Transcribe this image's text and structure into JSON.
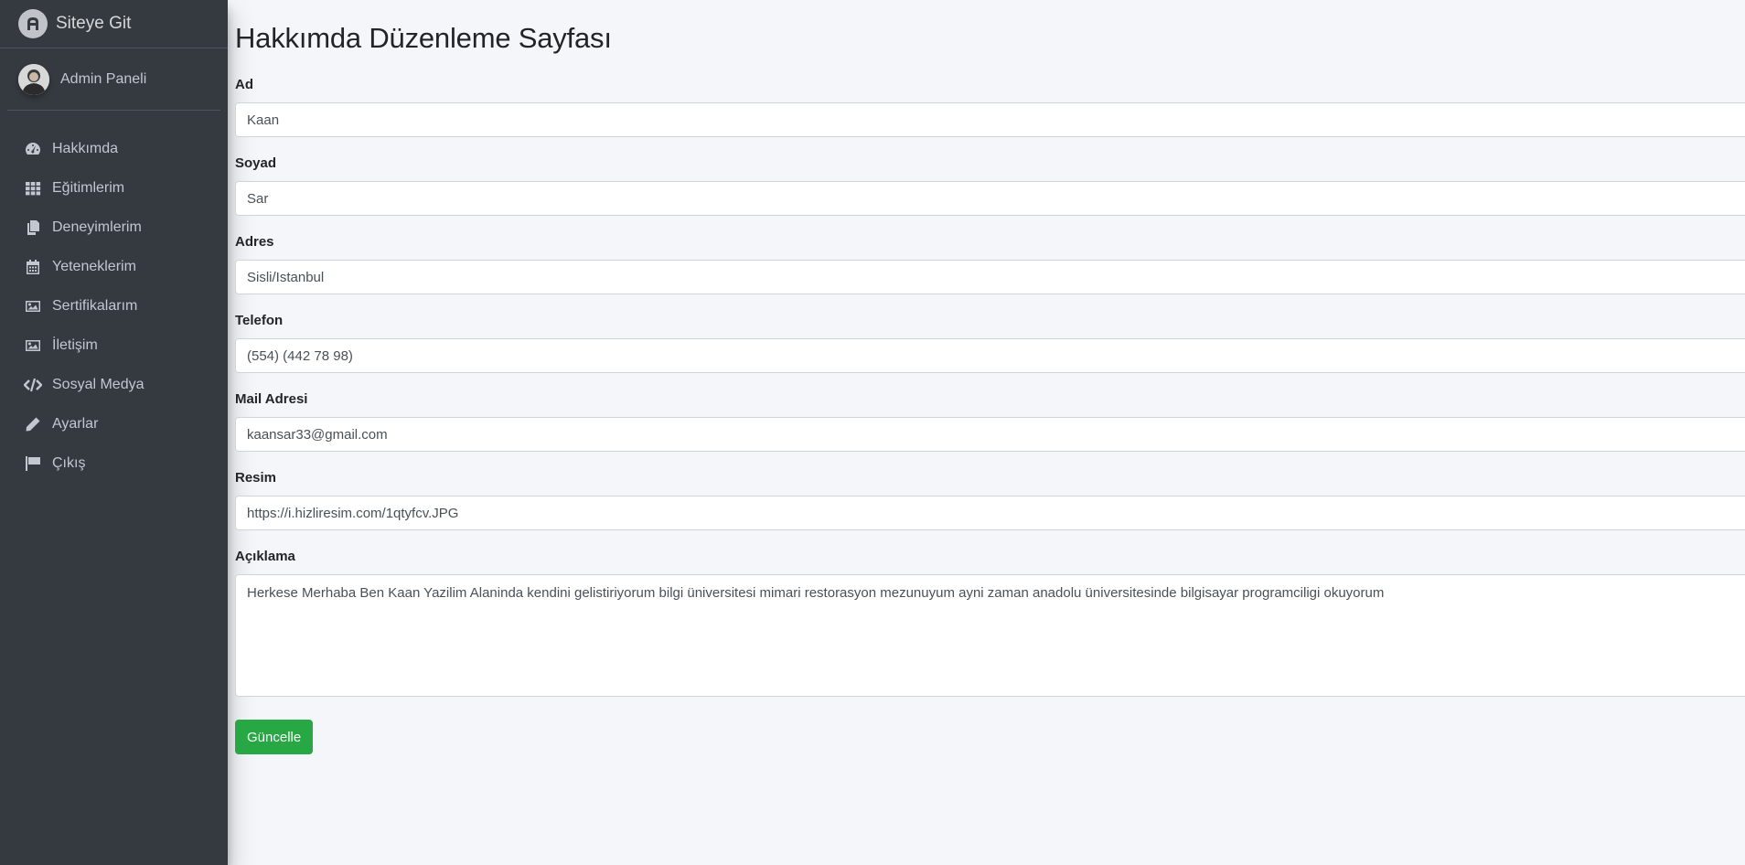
{
  "sidebar": {
    "brand": "Siteye Git",
    "user": "Admin Paneli",
    "items": [
      {
        "label": "Hakkımda",
        "icon": "tachometer-icon"
      },
      {
        "label": "Eğitimlerim",
        "icon": "grid-icon"
      },
      {
        "label": "Deneyimlerim",
        "icon": "copy-icon"
      },
      {
        "label": "Yeteneklerim",
        "icon": "calendar-icon"
      },
      {
        "label": "Sertifikalarım",
        "icon": "image-icon"
      },
      {
        "label": "İletişim",
        "icon": "image-icon"
      },
      {
        "label": "Sosyal Medya",
        "icon": "code-icon"
      },
      {
        "label": "Ayarlar",
        "icon": "pencil-icon"
      },
      {
        "label": "Çıkış",
        "icon": "flag-icon"
      }
    ]
  },
  "page": {
    "title": "Hakkımda Düzenleme Sayfası",
    "fields": {
      "ad": {
        "label": "Ad",
        "value": "Kaan"
      },
      "soyad": {
        "label": "Soyad",
        "value": "Sar"
      },
      "adres": {
        "label": "Adres",
        "value": "Sisli/Istanbul"
      },
      "telefon": {
        "label": "Telefon",
        "value": "(554) (442 78 98)"
      },
      "mail": {
        "label": "Mail Adresi",
        "value": "kaansar33@gmail.com"
      },
      "resim": {
        "label": "Resim",
        "value": "https://i.hizliresim.com/1qtyfcv.JPG"
      },
      "aciklama": {
        "label": "Açıklama",
        "value": "Herkese Merhaba Ben Kaan Yazilim Alaninda kendini gelistiriyorum bilgi üniversitesi mimari restorasyon mezunuyum ayni zaman anadolu üniversitesinde bilgisayar programciligi okuyorum"
      }
    },
    "submit_label": "Güncelle"
  },
  "colors": {
    "sidebar_bg": "#343a40",
    "content_bg": "#f4f6f9",
    "success": "#28a745"
  }
}
